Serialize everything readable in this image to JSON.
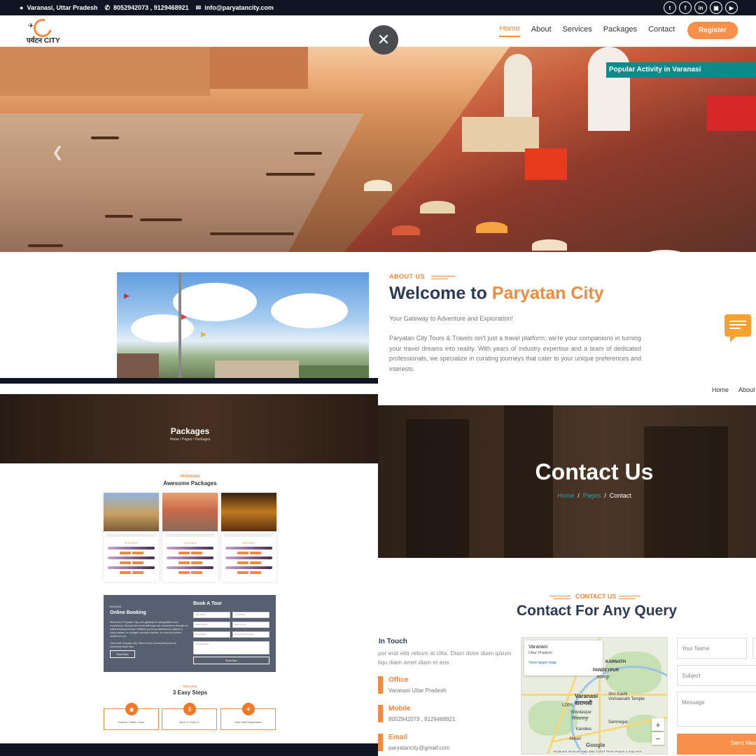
{
  "topbar": {
    "location": "Varanasi, Uttar Pradesh",
    "phone": "8052942073 , 9129468921",
    "email": "info@paryatancity.com",
    "social": [
      "twitter-icon",
      "facebook-icon",
      "linkedin-icon",
      "instagram-icon",
      "youtube-icon"
    ]
  },
  "nav": {
    "logo_text": "पर्यटन CITY",
    "items": [
      "Home",
      "About",
      "Services",
      "Packages",
      "Contact"
    ],
    "active": "Home",
    "register": "Register"
  },
  "hero": {
    "badge": "Popular Activity in Varanasi"
  },
  "about": {
    "tag": "ABOUT US",
    "title_prefix": "Welcome to ",
    "title_highlight": "Paryatan City",
    "subtitle": "Your Gateway to Adventure and Exploration!",
    "paragraph": "Paryatan City Tours & Travels isn't just a travel platform; we're your companions in turning your travel dreams into reality. With years of industry expertise and a team of dedicated professionals, we specialize in curating journeys that cater to your unique preferences and interests."
  },
  "mininav": [
    "Home",
    "About"
  ],
  "packages_page": {
    "title": "Packages",
    "breadcrumb": "Home / Pages / Packages",
    "section_tag": "PACKAGES",
    "section_title": "Awesome Packages",
    "booking": {
      "small": "BOOKING",
      "title": "Online Booking",
      "text": "Welcome to Paryatan City, your gateway to unforgettable travel experiences. Discover the world with ease and convenience through our online booking services. Whether you're an adventurous explorer, a luxury seeker, or a budget-conscious traveler, we have the perfect options for you.",
      "text2": "Travel with Paryatan City: Where Every Journey Becomes an Adventure! Book Now",
      "read_more": "Read More",
      "form_title": "Book A Tour",
      "fields": [
        "Your Name",
        "Your Email",
        "Select Option",
        "Date & Time",
        "Destination",
        "Number Of Travelers",
        "Your Message"
      ],
      "book_now": "Book Now"
    },
    "steps_tag": "PROCESS",
    "steps_title": "3 Easy Steps",
    "steps": [
      "Explore, Share, Soar!",
      "Book It, Rock It!",
      "Hear Well Departures"
    ]
  },
  "contact_page": {
    "title": "Contact Us",
    "crumb_home": "Home",
    "crumb_pages": "Pages",
    "crumb_current": "Contact",
    "section_tag": "CONTACT US",
    "section_title": "Contact For Any Query",
    "intouch": "In Touch",
    "intouch_text1": "por erat elitr rebum at clita. Diam dolor diam ipsum",
    "intouch_text2": "liqu diam amet diam et eos",
    "office_label": "Office",
    "office_value": "Varanasi Uttar Pradesh",
    "mobile_label": "Mobile",
    "mobile_value": "8052942073 , 9129468921",
    "email_label": "Email",
    "email_value": "paryatancity@gmail.com",
    "map": {
      "place": "Varanasi",
      "region": "Uttar Pradesh",
      "link": "View larger map",
      "labels": [
        "KARNATH",
        "PANDEYPUR",
        "पांडेयपुर",
        "Varanasi",
        "वाराणसी",
        "Shri Kashi",
        "Vishwanath Temple",
        "LOPS",
        "Shivdaspur",
        "शिवदासपुर",
        "Kandwa",
        "Akhari",
        "Samnegar"
      ],
      "footer": "Keyboard shortcuts    Map data ©2024    Terms    Report a map error",
      "google": "Google"
    },
    "form": {
      "name": "Your Name",
      "subject": "Subject",
      "message": "Message",
      "send": "Send Message"
    }
  }
}
